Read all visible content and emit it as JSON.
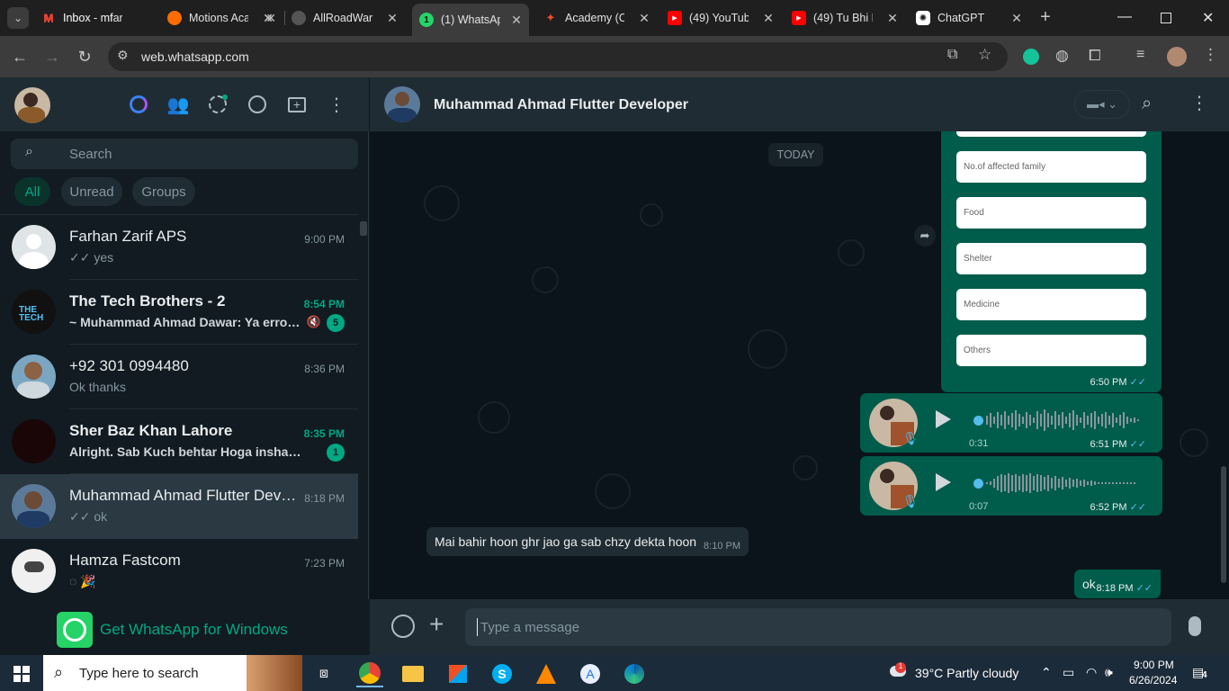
{
  "browser": {
    "tabs": [
      {
        "label": "Inbox - mfar",
        "icon": "gmail-icon",
        "color": "#ea4335",
        "glyph": "M"
      },
      {
        "label": "Motions Aca",
        "icon": "motions-icon",
        "color": "#ff6d00",
        "glyph": "●"
      },
      {
        "label": "AllRoadWarr",
        "icon": "github-icon",
        "color": "#444444",
        "glyph": "●"
      },
      {
        "label": "(1) WhatsAp",
        "icon": "whatsapp-icon",
        "color": "#25d366",
        "glyph": "1"
      },
      {
        "label": "Academy (Co",
        "icon": "figma-icon",
        "color": "#f24e1e",
        "glyph": "✦"
      },
      {
        "label": "(49) YouTube",
        "icon": "youtube-icon",
        "color": "#ff0000",
        "glyph": "▶"
      },
      {
        "label": "(49) Tu Bhi K",
        "icon": "youtube-icon",
        "color": "#ff0000",
        "glyph": "▶"
      },
      {
        "label": "ChatGPT",
        "icon": "chatgpt-icon",
        "color": "#ffffff",
        "glyph": "✺"
      }
    ],
    "url": "web.whatsapp.com"
  },
  "sidebar": {
    "search_placeholder": "Search",
    "filters": [
      "All",
      "Unread",
      "Groups"
    ],
    "chats": [
      {
        "name": "Farhan Zarif APS",
        "time": "9:00 PM",
        "preview": "✓✓ yes",
        "bold": false,
        "badge": "",
        "avatar_color": "#dfe5e7"
      },
      {
        "name": "The Tech Brothers - 2",
        "time": "8:54 PM",
        "preview": "~ Muhammad Ahmad Dawar: Ya error …",
        "bold": true,
        "badge": "5",
        "muted": true,
        "avatar_color": "#111111"
      },
      {
        "name": "+92 301 0994480",
        "time": "8:36 PM",
        "preview": "Ok thanks",
        "bold": false,
        "badge": "",
        "avatar_color": "#7aa6c2"
      },
      {
        "name": "Sher Baz Khan Lahore",
        "time": "8:35 PM",
        "preview": "Alright. Sab Kuch behtar Hoga inshallah",
        "bold": true,
        "badge": "1",
        "avatar_color": "#1a0606"
      },
      {
        "name": "Muhammad Ahmad Flutter Deve...",
        "time": "8:18 PM",
        "preview": "✓✓ ok",
        "bold": false,
        "badge": "",
        "selected": true,
        "avatar_color": "#3d5a80"
      },
      {
        "name": "Hamza Fastcom",
        "time": "7:23 PM",
        "preview": "◌ 🎉",
        "bold": false,
        "badge": "",
        "avatar_color": "#f0f0f0"
      }
    ],
    "get_app": "Get WhatsApp for Windows"
  },
  "conversation": {
    "contact_name": "Muhammad Ahmad Flutter Developer",
    "date_chip": "TODAY",
    "form_fields": [
      "No.of affected family",
      "Food",
      "Shelter",
      "Medicine",
      "Others"
    ],
    "form_time": "6:50 PM",
    "voice_notes": [
      {
        "duration": "0:31",
        "time": "6:51 PM"
      },
      {
        "duration": "0:07",
        "time": "6:52 PM"
      }
    ],
    "incoming": {
      "text": "Mai bahir hoon ghr jao ga sab chzy dekta hoon",
      "time": "8:10 PM"
    },
    "outgoing_last": {
      "text": "ok",
      "time": "8:18 PM"
    },
    "input_placeholder": "Type a message"
  },
  "taskbar": {
    "search_placeholder": "Type here to search",
    "weather": "39°C  Partly cloudy",
    "time": "9:00 PM",
    "date": "6/26/2024",
    "notifications": "4"
  }
}
